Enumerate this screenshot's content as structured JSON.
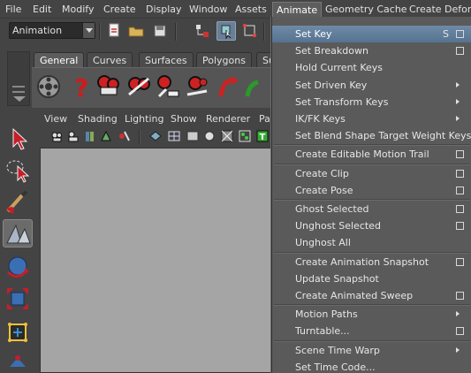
{
  "menubar": {
    "items": [
      "File",
      "Edit",
      "Modify",
      "Create",
      "Display",
      "Window",
      "Assets",
      "Animate",
      "Geometry Cache",
      "Create Deform"
    ],
    "active": "Animate"
  },
  "statusline": {
    "mode": "Animation"
  },
  "shelf": {
    "tabs": [
      "General",
      "Curves",
      "Surfaces",
      "Polygons",
      "Su"
    ],
    "active_tab": "General"
  },
  "viewport": {
    "menu": [
      "View",
      "Shading",
      "Lighting",
      "Show",
      "Renderer",
      "Pa"
    ]
  },
  "animate_menu": {
    "items": [
      {
        "label": "Set Key",
        "hotkey": "S",
        "option_box": true,
        "submenu": false,
        "highlighted": true
      },
      {
        "label": "Set Breakdown",
        "hotkey": "",
        "option_box": true,
        "submenu": false
      },
      {
        "label": "Hold Current Keys",
        "hotkey": "",
        "option_box": false,
        "submenu": false
      },
      {
        "label": "Set Driven Key",
        "hotkey": "",
        "option_box": false,
        "submenu": true
      },
      {
        "label": "Set Transform Keys",
        "hotkey": "",
        "option_box": false,
        "submenu": true
      },
      {
        "label": "IK/FK Keys",
        "hotkey": "",
        "option_box": false,
        "submenu": true
      },
      {
        "label": "Set Blend Shape Target Weight Keys",
        "hotkey": "",
        "option_box": false,
        "submenu": false
      },
      {
        "separator": true
      },
      {
        "label": "Create Editable Motion Trail",
        "hotkey": "",
        "option_box": true,
        "submenu": false
      },
      {
        "separator": true
      },
      {
        "label": "Create Clip",
        "hotkey": "",
        "option_box": true,
        "submenu": false
      },
      {
        "label": "Create Pose",
        "hotkey": "",
        "option_box": true,
        "submenu": false
      },
      {
        "separator": true
      },
      {
        "label": "Ghost Selected",
        "hotkey": "",
        "option_box": true,
        "submenu": false
      },
      {
        "label": "Unghost Selected",
        "hotkey": "",
        "option_box": true,
        "submenu": false
      },
      {
        "label": "Unghost All",
        "hotkey": "",
        "option_box": false,
        "submenu": false
      },
      {
        "separator": true
      },
      {
        "label": "Create Animation Snapshot",
        "hotkey": "",
        "option_box": true,
        "submenu": false
      },
      {
        "label": "Update Snapshot",
        "hotkey": "",
        "option_box": false,
        "submenu": false
      },
      {
        "label": "Create Animated Sweep",
        "hotkey": "",
        "option_box": true,
        "submenu": false
      },
      {
        "separator": true
      },
      {
        "label": "Motion Paths",
        "hotkey": "",
        "option_box": false,
        "submenu": true
      },
      {
        "label": "Turntable...",
        "hotkey": "",
        "option_box": true,
        "submenu": false
      },
      {
        "separator": true
      },
      {
        "label": "Scene Time Warp",
        "hotkey": "",
        "option_box": false,
        "submenu": true
      },
      {
        "label": "Set Time Code...",
        "hotkey": "",
        "option_box": false,
        "submenu": false
      }
    ]
  },
  "colors": {
    "ui_bg": "#444444",
    "menu_bg": "#5a5a5a",
    "highlight": "#6a86a3",
    "viewport": "#a5a5a5"
  }
}
